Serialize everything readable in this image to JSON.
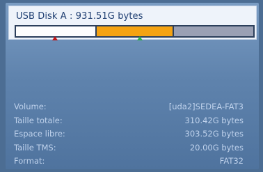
{
  "disk": {
    "title": "USB Disk A : 931.51G bytes",
    "usage_bar": {
      "colors": {
        "free": "#fdfdfd",
        "used": "#f5a312",
        "tms": "#9aa0b4",
        "marker_red": "#c01515",
        "marker_green": "#2fb04a"
      }
    }
  },
  "info": {
    "rows": [
      {
        "label": "Volume:",
        "value": "[uda2]SEDEA-FAT3"
      },
      {
        "label": "Taille totale:",
        "value": "310.42G bytes"
      },
      {
        "label": "Espace libre:",
        "value": "303.52G bytes"
      },
      {
        "label": "Taille TMS:",
        "value": "20.00G bytes"
      },
      {
        "label": "Format:",
        "value": "FAT32"
      }
    ]
  }
}
